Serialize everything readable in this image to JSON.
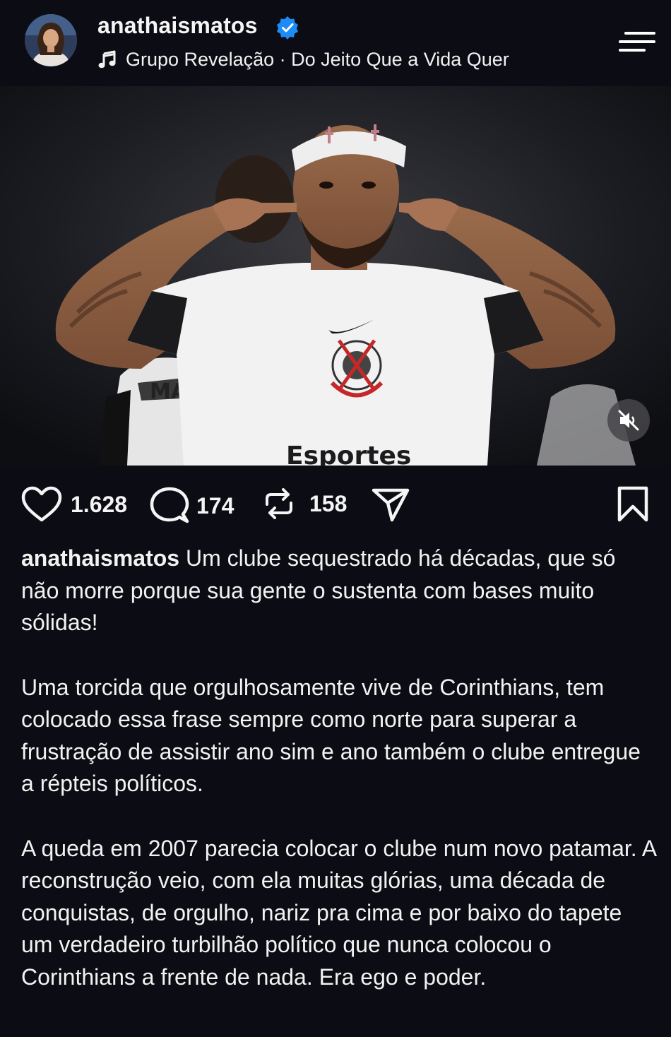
{
  "post": {
    "username": "anathaismatos",
    "verified": true,
    "audio": "Grupo Revelação · Do Jeito Que a Vida Quer"
  },
  "media": {
    "sponsor_text": "Esportes",
    "shirt_name": "MATHE",
    "icons": {
      "mute": "speaker-muted-icon"
    }
  },
  "actions": {
    "likes": "1.628",
    "comments": "174",
    "reposts": "158",
    "icons": [
      "heart-icon",
      "comment-icon",
      "repost-icon",
      "share-icon",
      "bookmark-icon"
    ]
  },
  "caption": {
    "username": "anathaismatos",
    "paragraph1": "Um clube sequestrado há décadas, que só não morre porque sua gente o sustenta com bases muito sólidas!",
    "paragraph2": "Uma torcida que orgulhosamente vive de Corinthians, tem colocado essa frase sempre como norte para superar a frustração de assistir ano sim e ano também o clube entregue a répteis políticos.",
    "paragraph3": "A queda em 2007 parecia colocar o clube num novo patamar. A reconstrução veio, com ela muitas glórias, uma década de conquistas, de orgulho, nariz pra cima e por baixo do tapete um verdadeiro turbilhão político que nunca colocou o Corinthians a frente de nada. Era ego e poder."
  },
  "colors": {
    "background": "#0c0c14",
    "text": "#f5f5f5",
    "verified_badge": "#1d8cf8"
  }
}
